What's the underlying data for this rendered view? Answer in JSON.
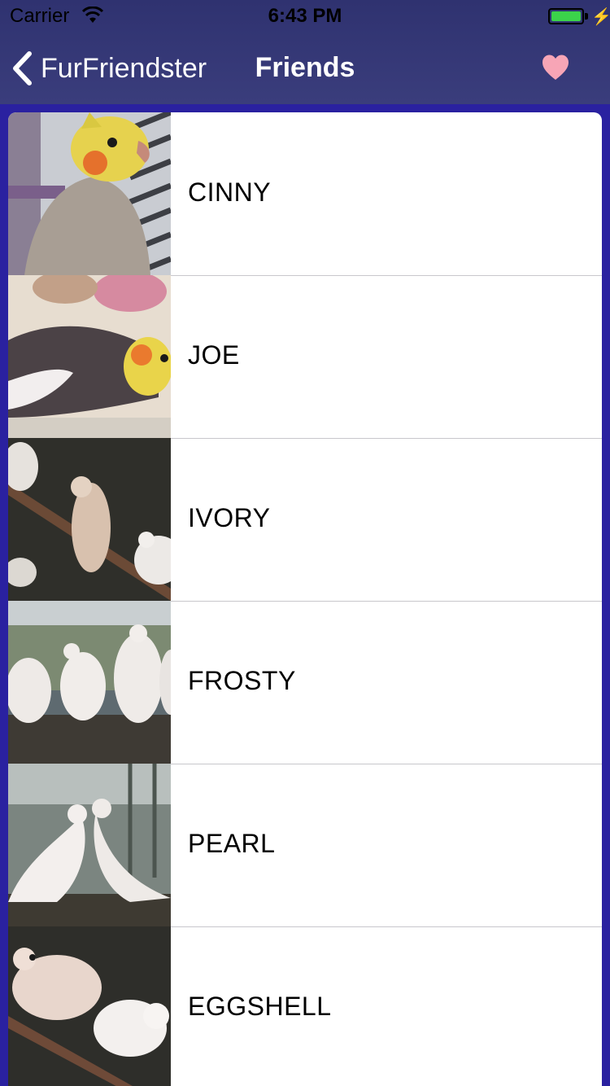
{
  "status_bar": {
    "carrier": "Carrier",
    "time": "6:43 PM",
    "battery_level": 1.0,
    "icons": [
      "wifi-icon",
      "battery-icon",
      "charging-bolt-icon"
    ]
  },
  "nav": {
    "back_label": "FurFriendster",
    "title": "Friends",
    "right_icon": "heart-icon",
    "heart_color": "#f7a5b6"
  },
  "colors": {
    "nav_background": "#383b79",
    "page_background": "#2a21a0",
    "separator": "#c8c7cc"
  },
  "friends": [
    {
      "name": "CINNY"
    },
    {
      "name": "JOE"
    },
    {
      "name": "IVORY"
    },
    {
      "name": "FROSTY"
    },
    {
      "name": "PEARL"
    },
    {
      "name": "EGGSHELL"
    }
  ]
}
